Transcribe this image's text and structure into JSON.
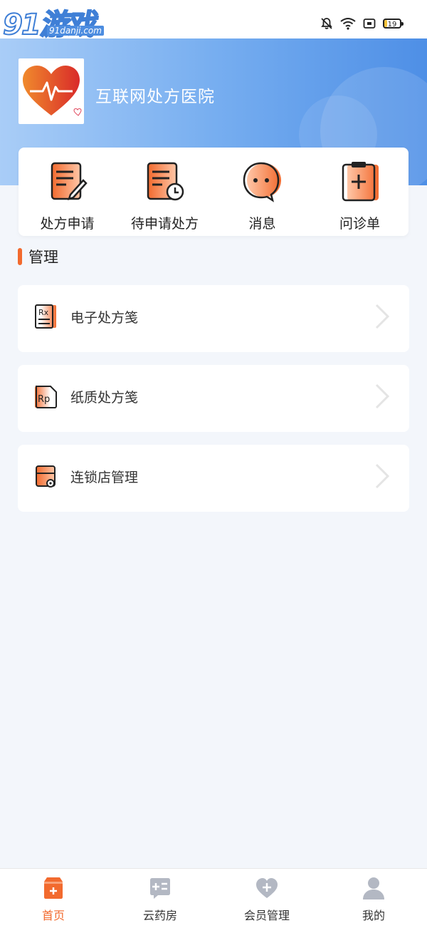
{
  "status_bar": {
    "watermark_main": "91游戏",
    "watermark_sub": "91danji.com",
    "battery_level": "19",
    "icons": [
      "bell-off-icon",
      "wifi-icon",
      "screen-record-icon",
      "battery-icon"
    ]
  },
  "header": {
    "hospital_name": "互联网处方医院",
    "logo_icon": "heart-pulse-icon"
  },
  "quick_actions": [
    {
      "label": "处方申请",
      "icon": "prescription-edit-icon"
    },
    {
      "label": "待申请处方",
      "icon": "pending-prescription-icon"
    },
    {
      "label": "消息",
      "icon": "message-icon"
    },
    {
      "label": "问诊单",
      "icon": "clipboard-plus-icon"
    }
  ],
  "section": {
    "title": "管理"
  },
  "manage_items": [
    {
      "label": "电子处方笺",
      "icon": "rx-document-icon"
    },
    {
      "label": "纸质处方笺",
      "icon": "rp-paper-icon"
    },
    {
      "label": "连锁店管理",
      "icon": "store-settings-icon"
    }
  ],
  "tabbar": {
    "tabs": [
      {
        "label": "首页",
        "icon": "home-icon",
        "active": true
      },
      {
        "label": "云药房",
        "icon": "pharmacy-icon",
        "active": false
      },
      {
        "label": "会员管理",
        "icon": "member-heart-icon",
        "active": false
      },
      {
        "label": "我的",
        "icon": "user-icon",
        "active": false
      }
    ]
  },
  "colors": {
    "accent": "#f26a2e",
    "header_start": "#a9cdf7",
    "header_end": "#4e8fe6",
    "background": "#f3f6fb"
  }
}
